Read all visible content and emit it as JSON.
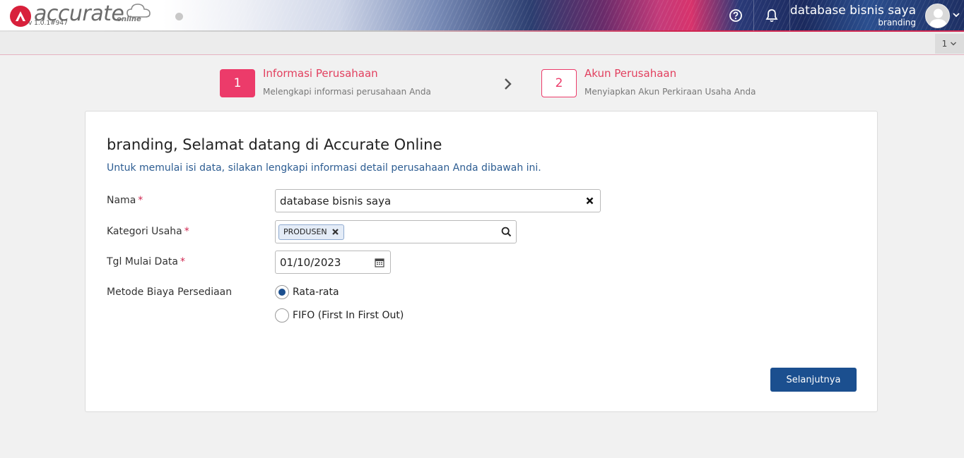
{
  "app": {
    "logo_text": "accurate",
    "logo_online": "online",
    "version": "v 1.0.1#947"
  },
  "header": {
    "user_name": "database bisnis saya",
    "user_sub": "branding"
  },
  "tabs": {
    "counter": "1"
  },
  "stepper": {
    "steps": [
      {
        "number": "1",
        "title": "Informasi Perusahaan",
        "subtitle": "Melengkapi informasi perusahaan Anda"
      },
      {
        "number": "2",
        "title": "Akun Perusahaan",
        "subtitle": "Menyiapkan Akun Perkiraan Usaha Anda"
      }
    ]
  },
  "form": {
    "title": "branding, Selamat datang di Accurate Online",
    "subtitle": "Untuk memulai isi data, silakan lengkapi informasi detail perusahaan Anda dibawah ini.",
    "required_mark": "*",
    "nama": {
      "label": "Nama",
      "value": "database bisnis saya"
    },
    "kategori": {
      "label": "Kategori Usaha",
      "tag": "PRODUSEN"
    },
    "tgl": {
      "label": "Tgl Mulai Data",
      "value": "01/10/2023"
    },
    "metode": {
      "label": "Metode Biaya Persediaan",
      "options": [
        {
          "label": "Rata-rata",
          "checked": true
        },
        {
          "label": "FIFO (First In First Out)",
          "checked": false
        }
      ]
    },
    "next_label": "Selanjutnya"
  }
}
